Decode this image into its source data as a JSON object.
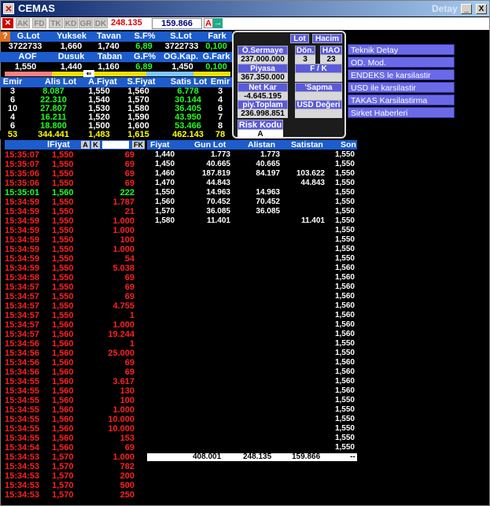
{
  "window": {
    "title": "CEMAS",
    "detail_label": "Detay",
    "min_btn": "_",
    "max_btn": "□",
    "close_btn": "X"
  },
  "toolbar": {
    "tabs": [
      "AK",
      "FD",
      "TK",
      "KD",
      "GR",
      "DK"
    ],
    "last_price": "248.135",
    "value": "159.866",
    "badge": "A",
    "arrow": "→"
  },
  "summary1": {
    "headers": [
      "G.Lot",
      "Yuksek",
      "Tavan",
      "S.F%",
      "S.Lot",
      "Fark"
    ],
    "values": [
      "3722733",
      "1,660",
      "1,740",
      "6,89",
      "3722733",
      "0,100"
    ]
  },
  "summary2": {
    "headers": [
      "AOF",
      "Dusuk",
      "Taban",
      "G.F%",
      "OG.Kap.",
      "G.Fark"
    ],
    "values": [
      "1,550",
      "1,440",
      "1,160",
      "6,89",
      "1,450",
      "0,100"
    ]
  },
  "depth": {
    "headers": [
      "Emir",
      "Alis Lot",
      "A.Fiyat",
      "S.Fiyat",
      "Satis Lot",
      "Emir"
    ],
    "rows": [
      [
        "3",
        "8.087",
        "1,550",
        "1,560",
        "6.778",
        "3"
      ],
      [
        "6",
        "22.310",
        "1,540",
        "1,570",
        "30.144",
        "4"
      ],
      [
        "10",
        "27.807",
        "1,530",
        "1,580",
        "36.405",
        "6"
      ],
      [
        "4",
        "16.211",
        "1,520",
        "1,590",
        "43.950",
        "7"
      ],
      [
        "6",
        "18.800",
        "1,500",
        "1,600",
        "53.466",
        "8"
      ]
    ],
    "totals": [
      "53",
      "344.441",
      "1,483",
      "1,615",
      "462.143",
      "78"
    ]
  },
  "info_panel": {
    "lot_btn": "Lot",
    "hacim_btn": "Hacim",
    "osermaye_label": "Ö.Sermaye",
    "osermaye_value": "237.000.000",
    "don_label": "Dön.",
    "don_value": "3",
    "hao_label": "HAO",
    "hao_value": "23",
    "piyasa_label": "Piyasa Değeri",
    "piyasa_value": "367.350.000",
    "fk_label": "F / K",
    "fk_value": "",
    "netkar_label": "Net Kar",
    "netkar_value": "-4.645.195",
    "sapma_label": "'Sapma",
    "sapma_value": "",
    "piytoplam_label": "piy.Toplam Lot",
    "piytoplam_value": "236.998.851",
    "usd_label": "USD Değeri",
    "usd_value": "",
    "risk_label": "Risk Kodu",
    "risk_value": "A"
  },
  "menu": [
    "Teknik Detay",
    "OD. Mod.",
    "ENDEKS le karsilastir",
    "USD ile karsilastir",
    "TAKAS Karsilastirma",
    "Sirket Haberleri"
  ],
  "trades": {
    "header": {
      "time": "",
      "price": "lFiyat",
      "a": "A",
      "k": "K",
      "fk": "FK"
    },
    "rows": [
      [
        "15:35:07",
        "1,550",
        "69",
        "r"
      ],
      [
        "15:35:07",
        "1,550",
        "69",
        "r"
      ],
      [
        "15:35:06",
        "1,550",
        "69",
        "r"
      ],
      [
        "15:35:06",
        "1,550",
        "69",
        "r"
      ],
      [
        "15:35:01",
        "1,560",
        "222",
        "g"
      ],
      [
        "15:34:59",
        "1,550",
        "1.787",
        "r"
      ],
      [
        "15:34:59",
        "1,550",
        "21",
        "r"
      ],
      [
        "15:34:59",
        "1,550",
        "1.000",
        "r"
      ],
      [
        "15:34:59",
        "1,550",
        "1.000",
        "r"
      ],
      [
        "15:34:59",
        "1,550",
        "100",
        "r"
      ],
      [
        "15:34:59",
        "1,550",
        "1.000",
        "r"
      ],
      [
        "15:34:59",
        "1,550",
        "54",
        "r"
      ],
      [
        "15:34:59",
        "1,550",
        "5.038",
        "r"
      ],
      [
        "15:34:58",
        "1,550",
        "69",
        "r"
      ],
      [
        "15:34:57",
        "1,550",
        "69",
        "r"
      ],
      [
        "15:34:57",
        "1,550",
        "69",
        "r"
      ],
      [
        "15:34:57",
        "1,550",
        "4.755",
        "r"
      ],
      [
        "15:34:57",
        "1,550",
        "1",
        "r"
      ],
      [
        "15:34:57",
        "1,560",
        "1.000",
        "r"
      ],
      [
        "15:34:57",
        "1,560",
        "19.244",
        "r"
      ],
      [
        "15:34:56",
        "1,560",
        "1",
        "r"
      ],
      [
        "15:34:56",
        "1,560",
        "25.000",
        "r"
      ],
      [
        "15:34:56",
        "1,560",
        "69",
        "r"
      ],
      [
        "15:34:56",
        "1,560",
        "69",
        "r"
      ],
      [
        "15:34:55",
        "1,560",
        "3.617",
        "r"
      ],
      [
        "15:34:55",
        "1,560",
        "130",
        "r"
      ],
      [
        "15:34:55",
        "1,560",
        "100",
        "r"
      ],
      [
        "15:34:55",
        "1,560",
        "1.000",
        "r"
      ],
      [
        "15:34:55",
        "1,560",
        "10.000",
        "r"
      ],
      [
        "15:34:55",
        "1,560",
        "10.000",
        "r"
      ],
      [
        "15:34:55",
        "1,560",
        "153",
        "r"
      ],
      [
        "15:34:54",
        "1,560",
        "69",
        "r"
      ],
      [
        "15:34:53",
        "1,570",
        "1.000",
        "r"
      ],
      [
        "15:34:53",
        "1,570",
        "782",
        "r"
      ],
      [
        "15:34:53",
        "1,570",
        "200",
        "r"
      ],
      [
        "15:34:53",
        "1,570",
        "500",
        "r"
      ],
      [
        "15:34:53",
        "1,570",
        "250",
        "r"
      ]
    ]
  },
  "grid": {
    "headers": [
      "Fiyat",
      "Gun Lot",
      "Alistan",
      "Satistan",
      "Son"
    ],
    "rows": [
      [
        "1,440",
        "1.773",
        "1.773",
        "",
        "1,550"
      ],
      [
        "1,450",
        "40.665",
        "40.665",
        "",
        "1,550"
      ],
      [
        "1,460",
        "187.819",
        "84.197",
        "103.622",
        "1,550"
      ],
      [
        "1,470",
        "44.843",
        "",
        "44.843",
        "1,550"
      ],
      [
        "1,550",
        "14.963",
        "14.963",
        "",
        "1,550"
      ],
      [
        "1,560",
        "70.452",
        "70.452",
        "",
        "1,550"
      ],
      [
        "1,570",
        "36.085",
        "36.085",
        "",
        "1,550"
      ],
      [
        "1,580",
        "11.401",
        "",
        "11.401",
        "1,550"
      ]
    ],
    "son_tail": [
      "1,550",
      "1,550",
      "1,550",
      "1,550",
      "1,560",
      "1,560",
      "1,560",
      "1,560",
      "1,560",
      "1,560",
      "1,560",
      "1,560",
      "1,550",
      "1,550",
      "1,560",
      "1,560",
      "1,560",
      "1,560",
      "1,550",
      "1,550",
      "1,550",
      "1,550",
      "1,550",
      "1,550",
      "1,550",
      "1,550",
      "1,550",
      "1,550",
      "1,550",
      "1,550",
      "1,550"
    ],
    "totals": [
      "408.001",
      "248.135",
      "159.866",
      "--"
    ]
  }
}
